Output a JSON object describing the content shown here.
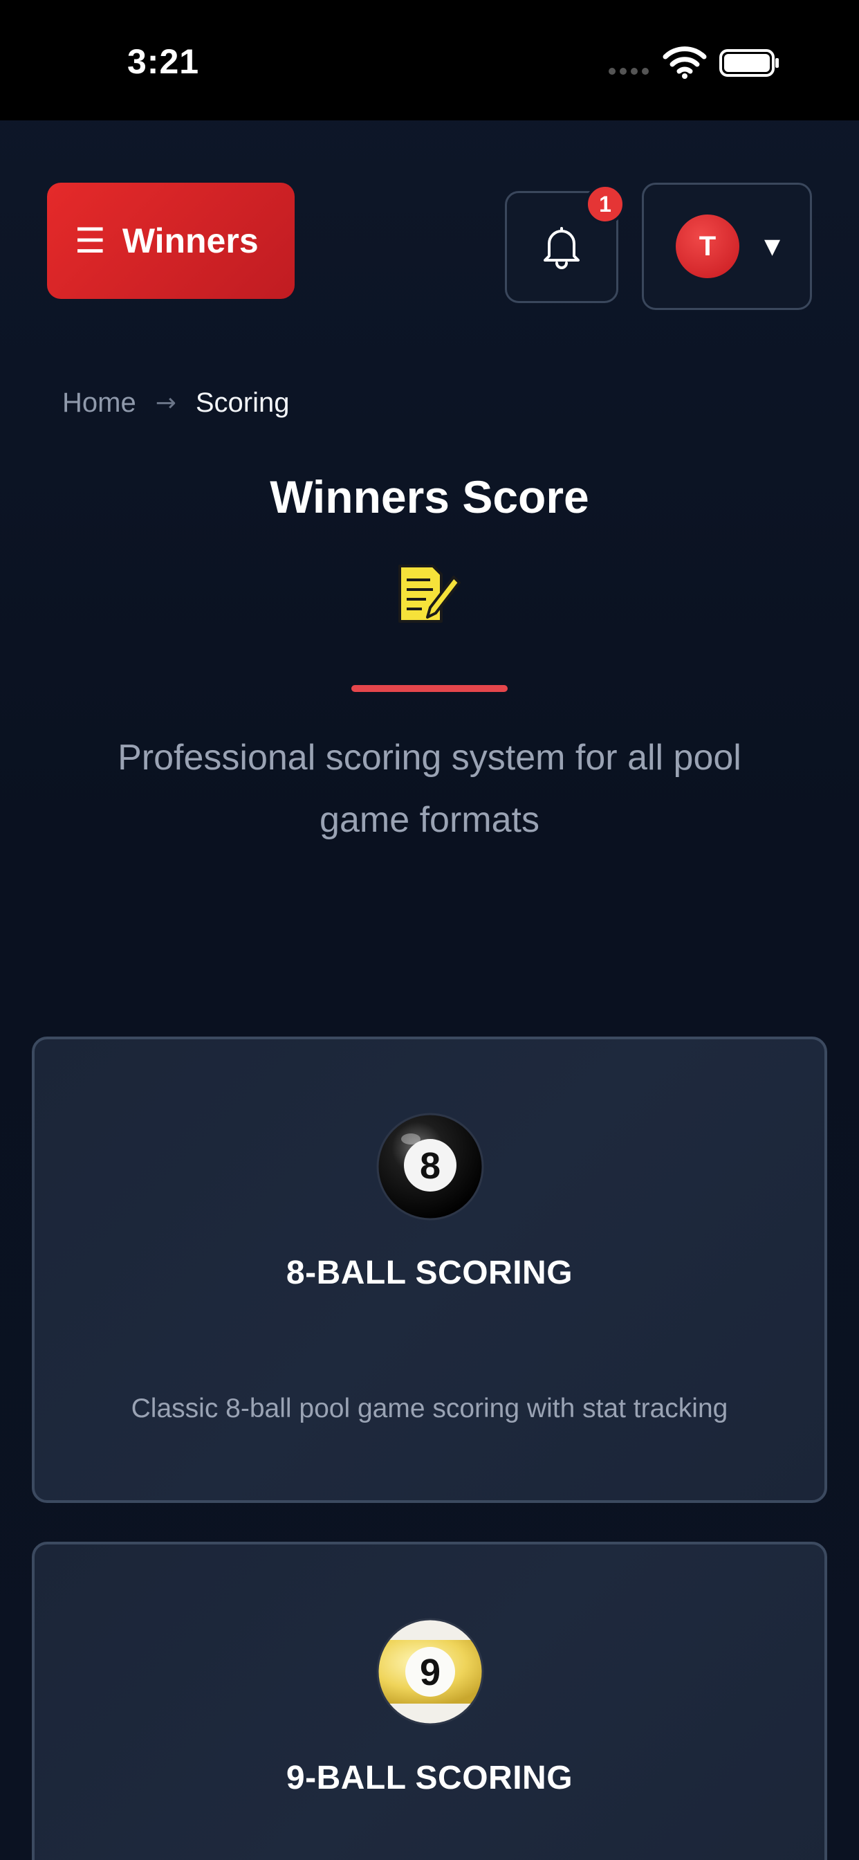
{
  "status_bar": {
    "time": "3:21"
  },
  "header": {
    "menu_label": "Winners",
    "menu_icon": "☰",
    "notification_count": "1",
    "avatar_initial": "T",
    "account_caret": "▼"
  },
  "breadcrumb": {
    "home": "Home",
    "separator": "→",
    "current": "Scoring"
  },
  "hero": {
    "title": "Winners Score",
    "icon": "scoresheet-icon",
    "subtitle": "Professional scoring system for all pool game formats"
  },
  "cards": [
    {
      "title": "8-BALL SCORING",
      "description": "Classic 8-ball pool game scoring with stat tracking",
      "icon": "eight-ball-icon",
      "ball_number": "8"
    },
    {
      "title": "9-BALL SCORING",
      "description": "",
      "icon": "nine-ball-icon",
      "ball_number": "9"
    }
  ],
  "colors": {
    "accent_red": "#e52a2a",
    "background": "#0b1120",
    "card_background": "#1e293d",
    "card_border": "#3c4a60",
    "muted_text": "#9aa3b4"
  }
}
